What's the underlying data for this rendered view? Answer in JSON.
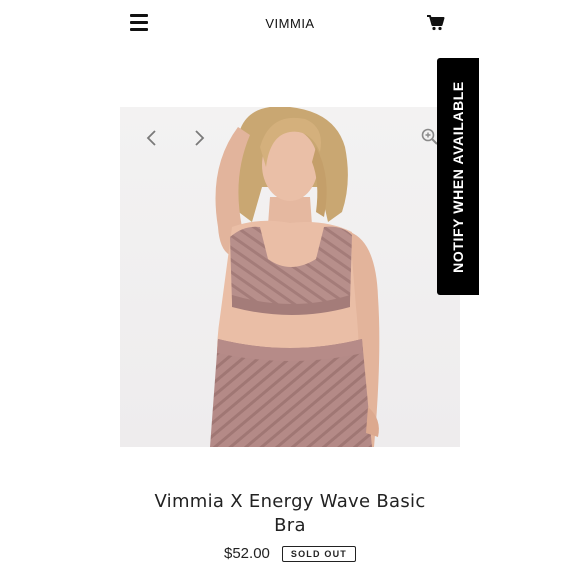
{
  "header": {
    "brand": "VIMMIA",
    "menu_icon": "hamburger-menu-icon",
    "cart_icon": "shopping-cart-icon"
  },
  "gallery": {
    "prev_icon": "chevron-left-icon",
    "next_icon": "chevron-right-icon",
    "zoom_icon": "zoom-in-icon"
  },
  "notify": {
    "label": "NOTIFY WHEN AVAILABLE"
  },
  "product": {
    "title_line1": "Vimmia X Energy Wave Basic",
    "title_line2": "Bra",
    "price": "$52.00",
    "status_badge": "SOLD OUT"
  },
  "colors": {
    "accent": "#000000",
    "garment": "#b48a87",
    "background": "#ffffff"
  }
}
